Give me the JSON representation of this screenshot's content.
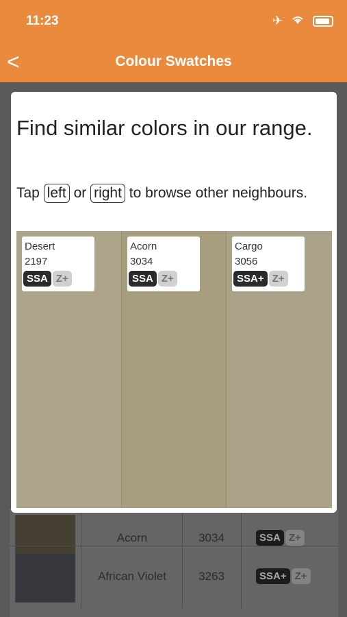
{
  "status_bar": {
    "time": "11:23"
  },
  "nav": {
    "title": "Colour Swatches",
    "back_glyph": "<"
  },
  "modal": {
    "heading": "Find similar colors in our range.",
    "instruction_prefix": "Tap",
    "left_label": "left",
    "or_text": "or",
    "right_label": "right",
    "instruction_suffix": "to browse other neighbours."
  },
  "swatches": [
    {
      "name": "Desert",
      "code": "2197",
      "tag1": "SSA",
      "tag2": "Z+",
      "color": "#ada58a"
    },
    {
      "name": "Acorn",
      "code": "3034",
      "tag1": "SSA",
      "tag2": "Z+",
      "color": "#a89d7e"
    },
    {
      "name": "Cargo",
      "code": "3056",
      "tag1": "SSA+",
      "tag2": "Z+",
      "color": "#aaa38a"
    }
  ],
  "underlay_rows": [
    {
      "name": "Acorn",
      "code": "3034",
      "tag1": "SSA",
      "tag2": "Z+",
      "color": "#6b634e"
    },
    {
      "name": "African Violet",
      "code": "3263",
      "tag1": "SSA+",
      "tag2": "Z+",
      "color": "#55575f"
    }
  ],
  "colors": {
    "accent": "#e98a3c"
  }
}
